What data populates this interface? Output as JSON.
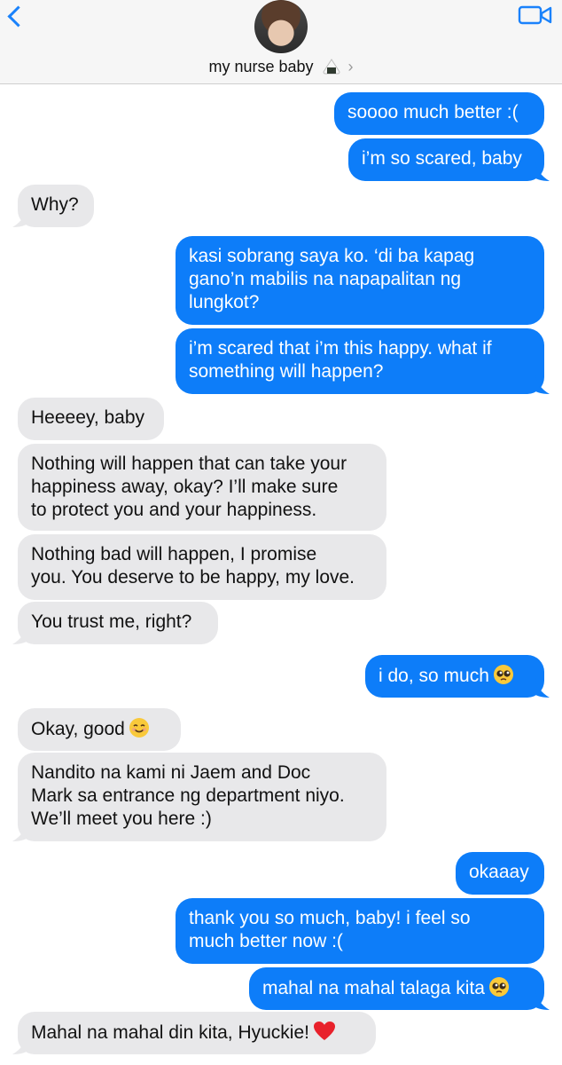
{
  "header": {
    "contact_name": "my nurse baby",
    "chevron": "›",
    "icons": [
      "back-chevron-icon",
      "onigiri-emoji",
      "video-call-icon"
    ]
  },
  "colors": {
    "outgoing": "#0d7df9",
    "incoming": "#e8e8ea",
    "accent": "#1a82fb"
  },
  "messages": [
    {
      "from": "me",
      "lines": [
        "soooo much better :("
      ]
    },
    {
      "from": "me",
      "lines": [
        "i’m so scared, baby"
      ]
    },
    {
      "from": "them",
      "lines": [
        "Why?"
      ]
    },
    {
      "from": "me",
      "lines": [
        "kasi sobrang saya ko. ‘di ba kapag",
        "gano’n mabilis na napapalitan ng",
        "lungkot?"
      ]
    },
    {
      "from": "me",
      "lines": [
        "i’m scared that i’m this happy. what if",
        "something will happen?"
      ]
    },
    {
      "from": "them",
      "lines": [
        "Heeeey, baby"
      ]
    },
    {
      "from": "them",
      "lines": [
        "Nothing will happen that can take your",
        "happiness away, okay? I’ll make sure",
        "to protect you and your happiness."
      ]
    },
    {
      "from": "them",
      "lines": [
        "Nothing bad will happen, I promise",
        "you. You deserve to be happy, my love."
      ]
    },
    {
      "from": "them",
      "lines": [
        "You trust me, right?"
      ]
    },
    {
      "from": "me",
      "lines": [
        "i do, so much"
      ],
      "emoji": "pleading-face"
    },
    {
      "from": "them",
      "lines": [
        "Okay, good"
      ],
      "emoji": "smiling-face"
    },
    {
      "from": "them",
      "lines": [
        "Nandito na kami ni Jaem and Doc",
        "Mark sa entrance ng department niyo.",
        "We’ll meet you here :)"
      ]
    },
    {
      "from": "me",
      "lines": [
        "okaaay"
      ]
    },
    {
      "from": "me",
      "lines": [
        "thank you so much, baby! i feel so",
        "much better now :("
      ]
    },
    {
      "from": "me",
      "lines": [
        "mahal na mahal talaga kita"
      ],
      "emoji": "pleading-face"
    },
    {
      "from": "them",
      "lines": [
        "Mahal na mahal din kita, Hyuckie!"
      ],
      "emoji": "red-heart"
    }
  ]
}
